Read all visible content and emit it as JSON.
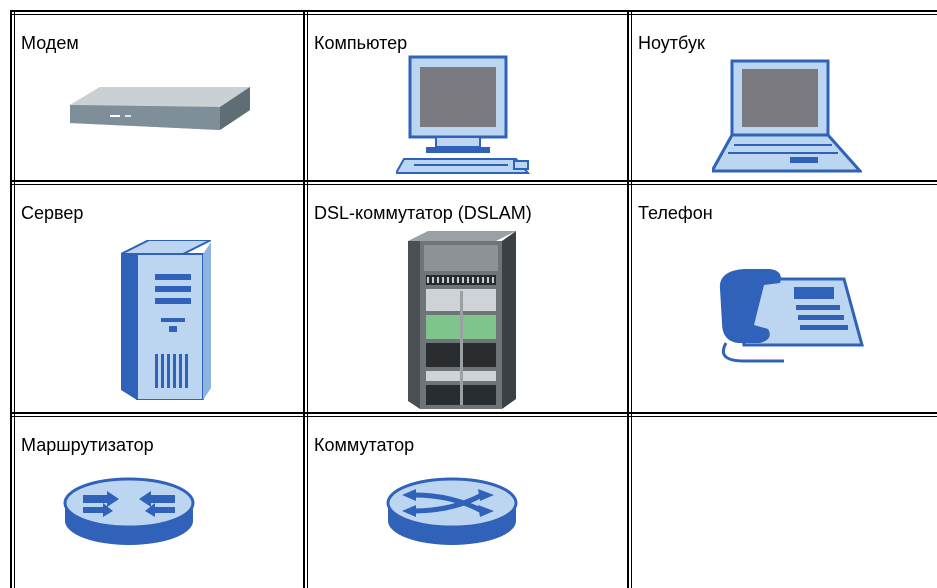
{
  "table": {
    "rows": [
      [
        {
          "label": "Модем",
          "icon": "modem-icon"
        },
        {
          "label": "Компьютер",
          "icon": "computer-icon"
        },
        {
          "label": "Ноутбук",
          "icon": "laptop-icon"
        }
      ],
      [
        {
          "label": "Сервер",
          "icon": "server-icon"
        },
        {
          "label": "DSL-коммутатор (DSLAM)",
          "icon": "dslam-icon"
        },
        {
          "label": "Телефон",
          "icon": "telephone-icon"
        }
      ],
      [
        {
          "label": "Маршрутизатор",
          "icon": "router-icon"
        },
        {
          "label": "Коммутатор",
          "icon": "switch-icon"
        },
        {
          "label": "",
          "icon": ""
        }
      ]
    ]
  },
  "colors": {
    "border": "#000000",
    "device_blue": "#2f62b8",
    "device_light_blue": "#bcd6f2",
    "device_gray": "#7f8f9a",
    "screen_gray": "#7a7a80"
  }
}
